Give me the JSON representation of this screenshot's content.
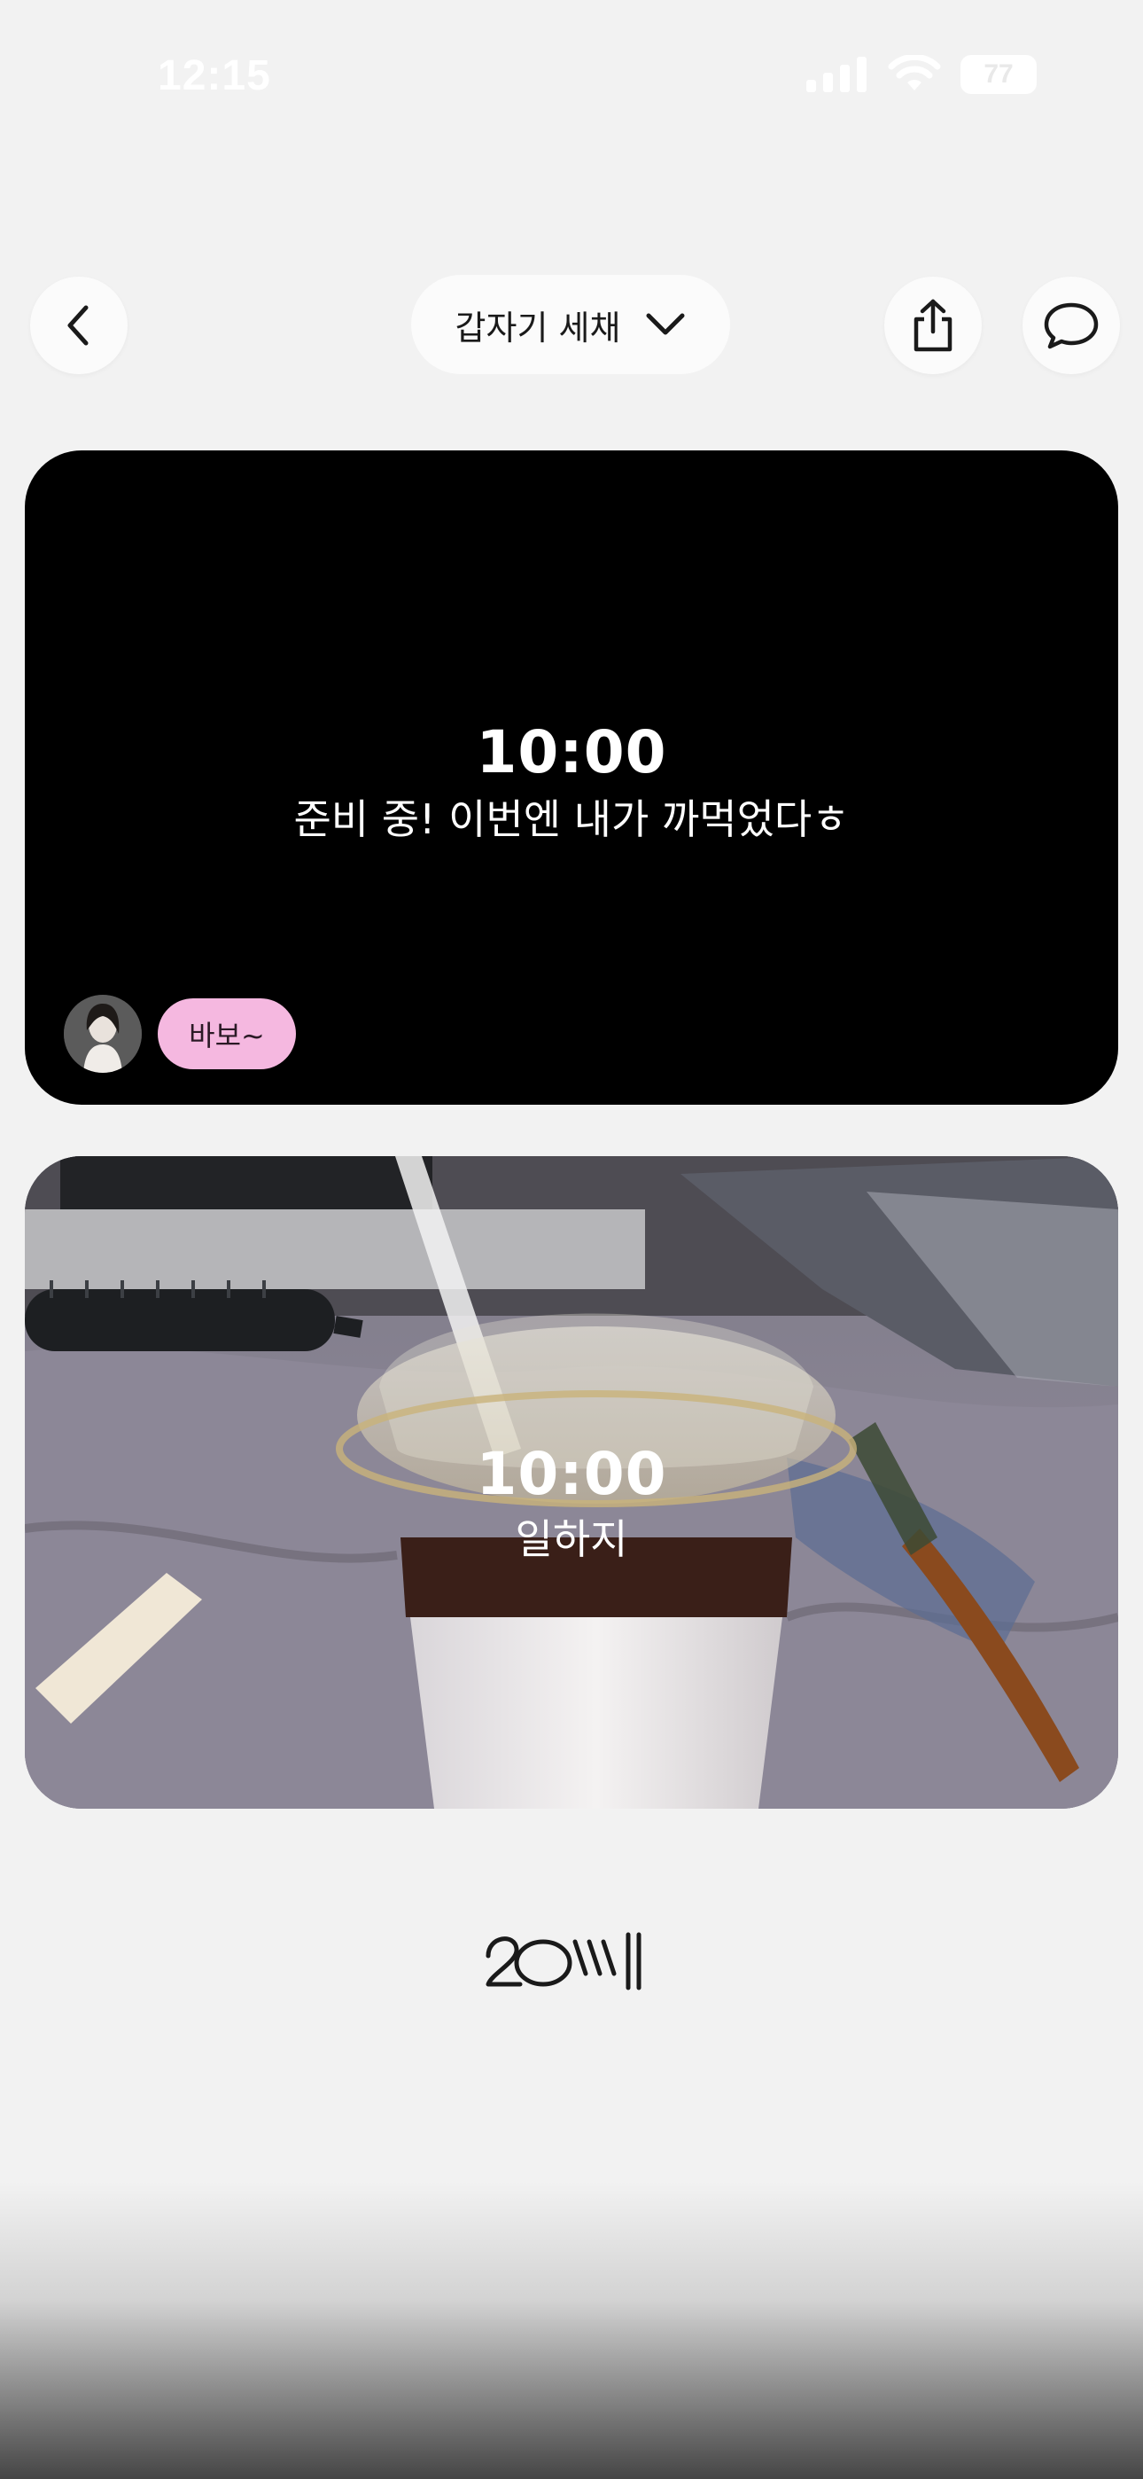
{
  "status_bar": {
    "time": "12:15",
    "battery": "77",
    "icons": [
      "signal-icon",
      "wifi-icon",
      "battery-icon"
    ]
  },
  "header": {
    "back_icon": "chevron-left-icon",
    "title": "갑자기 세채",
    "dropdown_icon": "chevron-down-icon",
    "share_icon": "share-icon",
    "comment_icon": "comment-icon"
  },
  "posts": [
    {
      "time": "10:00",
      "caption": "준비 중! 이번엔 내가 까먹었다ㅎ",
      "reaction": {
        "avatar": "avatar",
        "label": "바보~",
        "color": "#f5b8e0"
      }
    },
    {
      "time": "10:00",
      "caption": "일하지"
    }
  ],
  "footer": {
    "logo_text": "20세"
  }
}
